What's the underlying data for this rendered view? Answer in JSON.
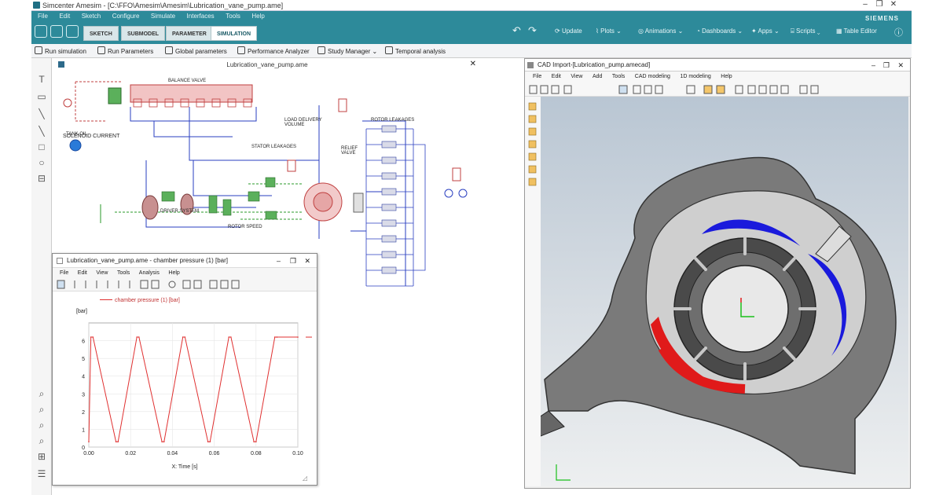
{
  "app": {
    "title": "Simcenter Amesim - [C:\\FFO\\Amesim\\Amesim\\Lubrication_vane_pump.ame]",
    "brand": "SIEMENS"
  },
  "menubar": [
    "File",
    "Edit",
    "Sketch",
    "Configure",
    "Simulate",
    "Interfaces",
    "Tools",
    "Help"
  ],
  "mode_tabs": [
    "SKETCH",
    "SUBMODEL",
    "PARAMETER",
    "SIMULATION"
  ],
  "ribbon_right": [
    "Update",
    "Plots",
    "Animations",
    "Dashboards",
    "Apps",
    "Scripts",
    "Table Editor"
  ],
  "sim_toolbar": [
    "Run simulation",
    "Run Parameters",
    "Global parameters",
    "Performance Analyzer",
    "Study Manager",
    "Temporal analysis"
  ],
  "sketch": {
    "title": "Lubrication_vane_pump.ame",
    "labels": [
      "SOLENOID CURRENT",
      "BALANCE VALVE",
      "TANK OIL",
      "LOAD DELIVERY VOLUME",
      "RELIEF VALVE",
      "STATOR LEAKAGES",
      "ROTOR LEAKAGES",
      "ROTOR SPEED",
      "DRIVER SYSTEM"
    ]
  },
  "cad": {
    "title": "CAD Import-[Lubrication_pump.amecad]",
    "menu": [
      "File",
      "Edit",
      "View",
      "Add",
      "Tools",
      "CAD modeling",
      "1D modeling",
      "Help"
    ]
  },
  "plot": {
    "title": "Lubrication_vane_pump.ame - chamber pressure (1) [bar]",
    "menu": [
      "File",
      "Edit",
      "View",
      "Tools",
      "Analysis",
      "Help"
    ],
    "legend": "chamber pressure (1) [bar]",
    "yunit": "[bar]",
    "xlabel": "X: Time [s]",
    "line_color": "#e03030"
  },
  "chart_data": {
    "type": "line",
    "title": "",
    "xlabel": "X: Time [s]",
    "ylabel": "[bar]",
    "xlim": [
      0,
      0.1
    ],
    "ylim": [
      0,
      7
    ],
    "xticks": [
      "0.00",
      "0.02",
      "0.04",
      "0.06",
      "0.08",
      "0.10"
    ],
    "yticks": [
      "0",
      "1",
      "2",
      "3",
      "4",
      "5",
      "6"
    ],
    "series": [
      {
        "name": "chamber pressure (1) [bar]",
        "x": [
          0,
          0.001,
          0.002,
          0.013,
          0.014,
          0.023,
          0.024,
          0.035,
          0.036,
          0.045,
          0.046,
          0.057,
          0.058,
          0.067,
          0.068,
          0.079,
          0.08,
          0.089,
          0.09,
          0.1
        ],
        "y": [
          0.3,
          6.2,
          6.2,
          0.3,
          0.3,
          6.2,
          6.2,
          0.3,
          0.3,
          6.2,
          6.2,
          0.3,
          0.3,
          6.2,
          6.2,
          0.3,
          0.3,
          6.2,
          6.2,
          6.2
        ]
      }
    ]
  }
}
